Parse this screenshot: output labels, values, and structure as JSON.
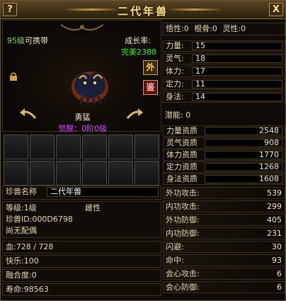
{
  "window": {
    "title": "二代年兽",
    "help_label": "?",
    "close_label": "X"
  },
  "pet": {
    "level_prefix": "95级",
    "level_suffix": "可携带",
    "growth_label": "成长率:",
    "growth_value": "完美2388",
    "btn_external": "外",
    "btn_appraise": "鉴",
    "temperament": "勇猛",
    "awaken": "觉醒：0阶0级"
  },
  "info": {
    "name_label": "珍兽名称",
    "name_value": "二代年兽",
    "level": "等级:1级",
    "gender": "雌性",
    "pet_id": "珍兽ID:000D6798",
    "spouse": "尚无配偶",
    "hp": "血:728 / 728",
    "happiness": "快乐:100",
    "fusion": "融合度:0",
    "lifespan": "寿命:98563"
  },
  "attributes": {
    "top": {
      "wuxing": "悟性:0",
      "gengu": "根骨:0",
      "lingxing": "灵性:0"
    },
    "items": [
      {
        "label": "力量:",
        "value": "15"
      },
      {
        "label": "灵气:",
        "value": "18"
      },
      {
        "label": "体力:",
        "value": "17"
      },
      {
        "label": "定力:",
        "value": "11"
      },
      {
        "label": "身法:",
        "value": "14"
      }
    ],
    "potential": "潜能:  0"
  },
  "aptitudes": [
    {
      "label": "力量资质",
      "value": "2548"
    },
    {
      "label": "灵气资质",
      "value": "908"
    },
    {
      "label": "体力资质",
      "value": "1770"
    },
    {
      "label": "定力资质",
      "value": "1268"
    },
    {
      "label": "身法资质",
      "value": "1608"
    }
  ],
  "combat": [
    {
      "label": "外功攻击:",
      "value": "539"
    },
    {
      "label": "内功攻击:",
      "value": "299"
    },
    {
      "label": "外功防御:",
      "value": "405"
    },
    {
      "label": "内功防御:",
      "value": "231"
    },
    {
      "label": "闪避:",
      "value": "30"
    },
    {
      "label": "命中:",
      "value": "93"
    },
    {
      "label": "会心攻击:",
      "value": "6"
    },
    {
      "label": "会心防御:",
      "value": "6"
    }
  ],
  "colors": {
    "title": "#ffe38a",
    "level_green": "#8fd35a",
    "growth_green": "#3ef03e",
    "awaken_purple": "#d646ff"
  }
}
